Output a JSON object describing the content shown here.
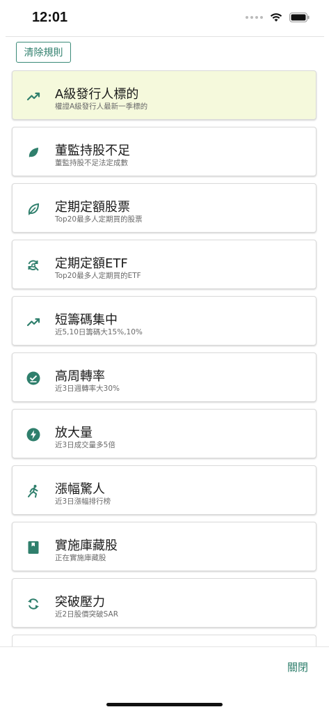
{
  "status": {
    "time": "12:01"
  },
  "clear_button": "清除規則",
  "close_button": "關閉",
  "items": [
    {
      "title": "A級發行人標的",
      "subtitle": "權證A級發行人最新一季標的",
      "icon": "trending-up-icon",
      "selected": true
    },
    {
      "title": "董監持股不足",
      "subtitle": "董監持股不足法定成數",
      "icon": "leaf-icon",
      "selected": false
    },
    {
      "title": "定期定額股票",
      "subtitle": "Top20最多人定期買的股票",
      "icon": "leaf-outline-icon",
      "selected": false
    },
    {
      "title": "定期定額ETF",
      "subtitle": "Top20最多人定期買的ETF",
      "icon": "refresh-search-icon",
      "selected": false
    },
    {
      "title": "短籌碼集中",
      "subtitle": "近5,10日籌碼大15%,10%",
      "icon": "trending-up-icon",
      "selected": false
    },
    {
      "title": "高周轉率",
      "subtitle": "近3日週轉率大30%",
      "icon": "check-circle-icon",
      "selected": false
    },
    {
      "title": "放大量",
      "subtitle": "近3日成交量多5倍",
      "icon": "bolt-circle-icon",
      "selected": false
    },
    {
      "title": "漲幅驚人",
      "subtitle": "近3日漲幅排行榜",
      "icon": "runner-icon",
      "selected": false
    },
    {
      "title": "實施庫藏股",
      "subtitle": "正在實施庫藏股",
      "icon": "book-icon",
      "selected": false
    },
    {
      "title": "突破壓力",
      "subtitle": "近2日股價突破SAR",
      "icon": "sync-icon",
      "selected": false
    }
  ],
  "colors": {
    "accent": "#2f7f6c",
    "selected_bg": "#f5f9dc"
  }
}
